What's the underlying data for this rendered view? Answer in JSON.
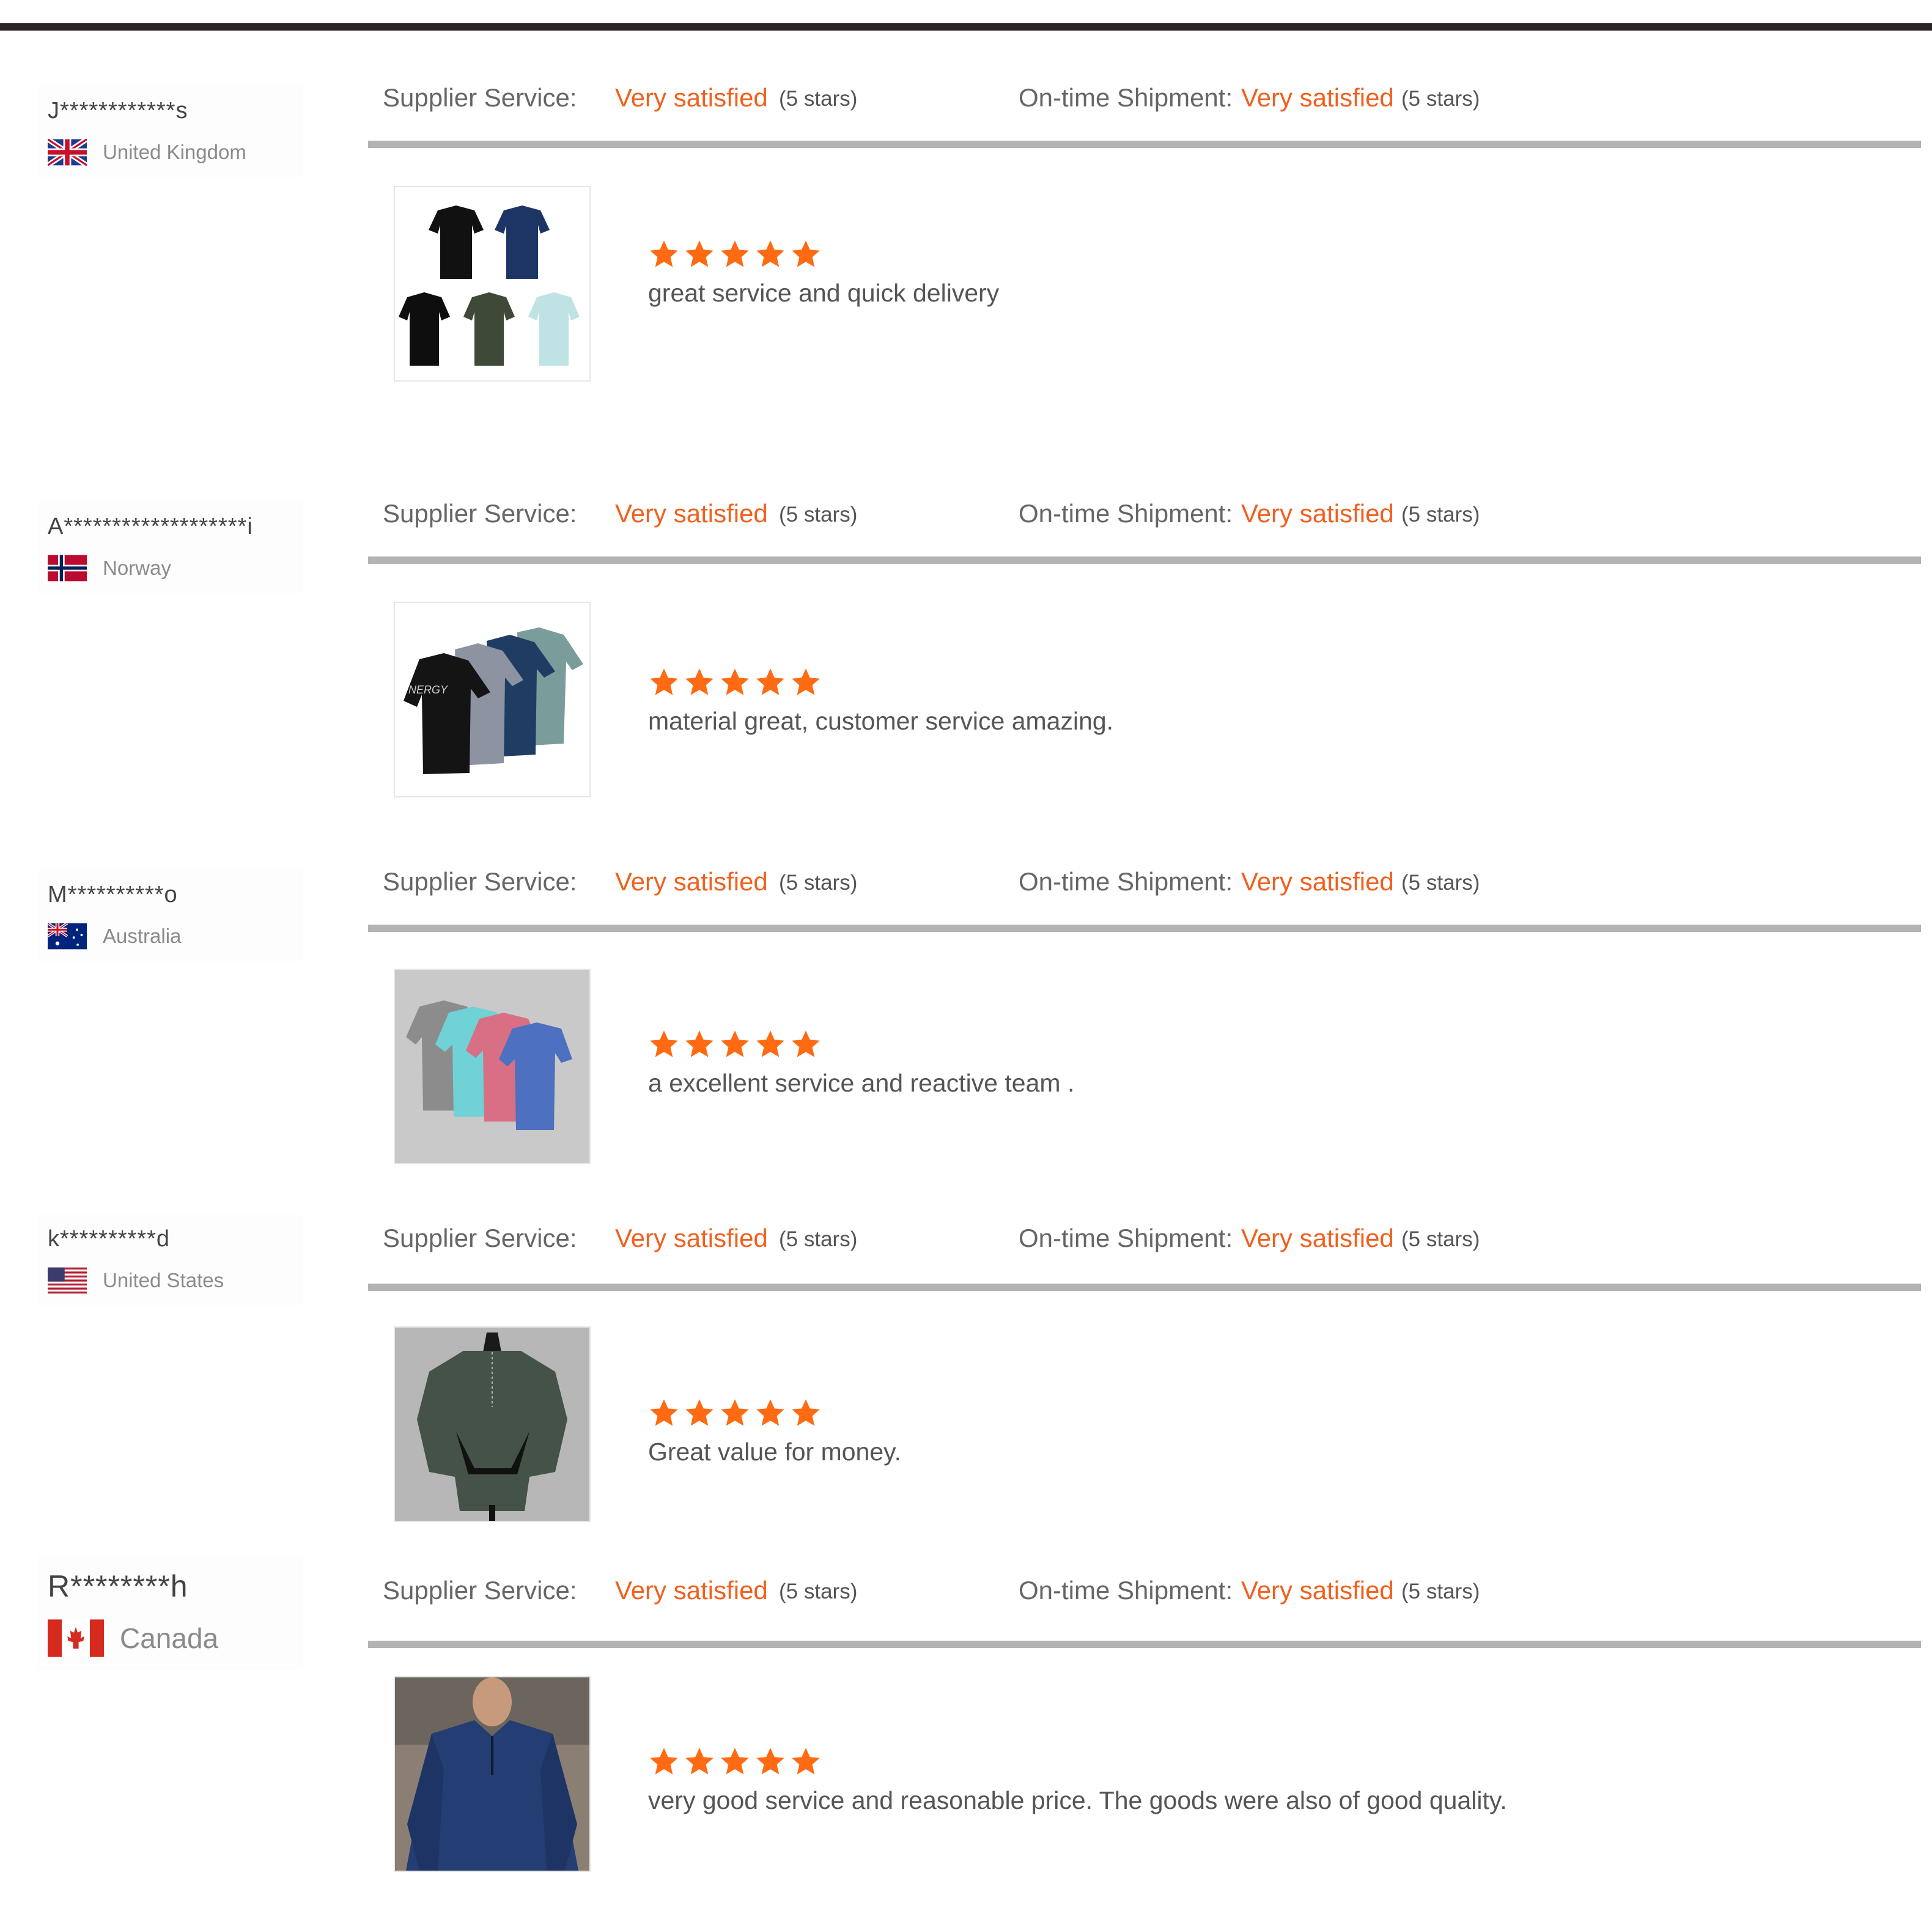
{
  "reviews": [
    {
      "user": "J************s",
      "country": "United Kingdom",
      "supplier_service_label": "Supplier Service:",
      "supplier_service_value": "Very satisfied",
      "supplier_service_stars": "(5 stars)",
      "shipment_label": "On-time Shipment:",
      "shipment_value": "Very satisfied",
      "shipment_stars": "(5 stars)",
      "rating": 5,
      "comment": "great service and quick delivery"
    },
    {
      "user": "A*******************i",
      "country": "Norway",
      "supplier_service_label": "Supplier Service:",
      "supplier_service_value": "Very satisfied",
      "supplier_service_stars": "(5 stars)",
      "shipment_label": "On-time Shipment:",
      "shipment_value": "Very satisfied",
      "shipment_stars": "(5 stars)",
      "rating": 5,
      "product_print": "NERGY",
      "comment": "material great, customer service amazing."
    },
    {
      "user": "M**********o",
      "country": "Australia",
      "supplier_service_label": "Supplier Service:",
      "supplier_service_value": "Very satisfied",
      "supplier_service_stars": "(5 stars)",
      "shipment_label": "On-time Shipment:",
      "shipment_value": "Very satisfied",
      "shipment_stars": "(5 stars)",
      "rating": 5,
      "comment": "a excellent service and reactive team ."
    },
    {
      "user": "k**********d",
      "country": "United States",
      "supplier_service_label": "Supplier Service:",
      "supplier_service_value": "Very satisfied",
      "supplier_service_stars": "(5 stars)",
      "shipment_label": "On-time Shipment:",
      "shipment_value": "Very satisfied",
      "shipment_stars": "(5 stars)",
      "rating": 5,
      "comment": "Great value for money."
    },
    {
      "user": "R********h",
      "country": "Canada",
      "supplier_service_label": "Supplier Service:",
      "supplier_service_value": "Very satisfied",
      "supplier_service_stars": "(5 stars)",
      "shipment_label": "On-time Shipment:",
      "shipment_value": "Very satisfied",
      "shipment_stars": "(5 stars)",
      "rating": 5,
      "comment": "very good service and reasonable price. The goods were also of good quality."
    }
  ],
  "colors": {
    "accent": "#f0611f",
    "star": "#ff6a13",
    "divider": "#b3b3b3"
  },
  "icons": [
    "flag-uk-icon",
    "flag-norway-icon",
    "flag-australia-icon",
    "flag-us-icon",
    "flag-canada-icon",
    "star-icon"
  ]
}
